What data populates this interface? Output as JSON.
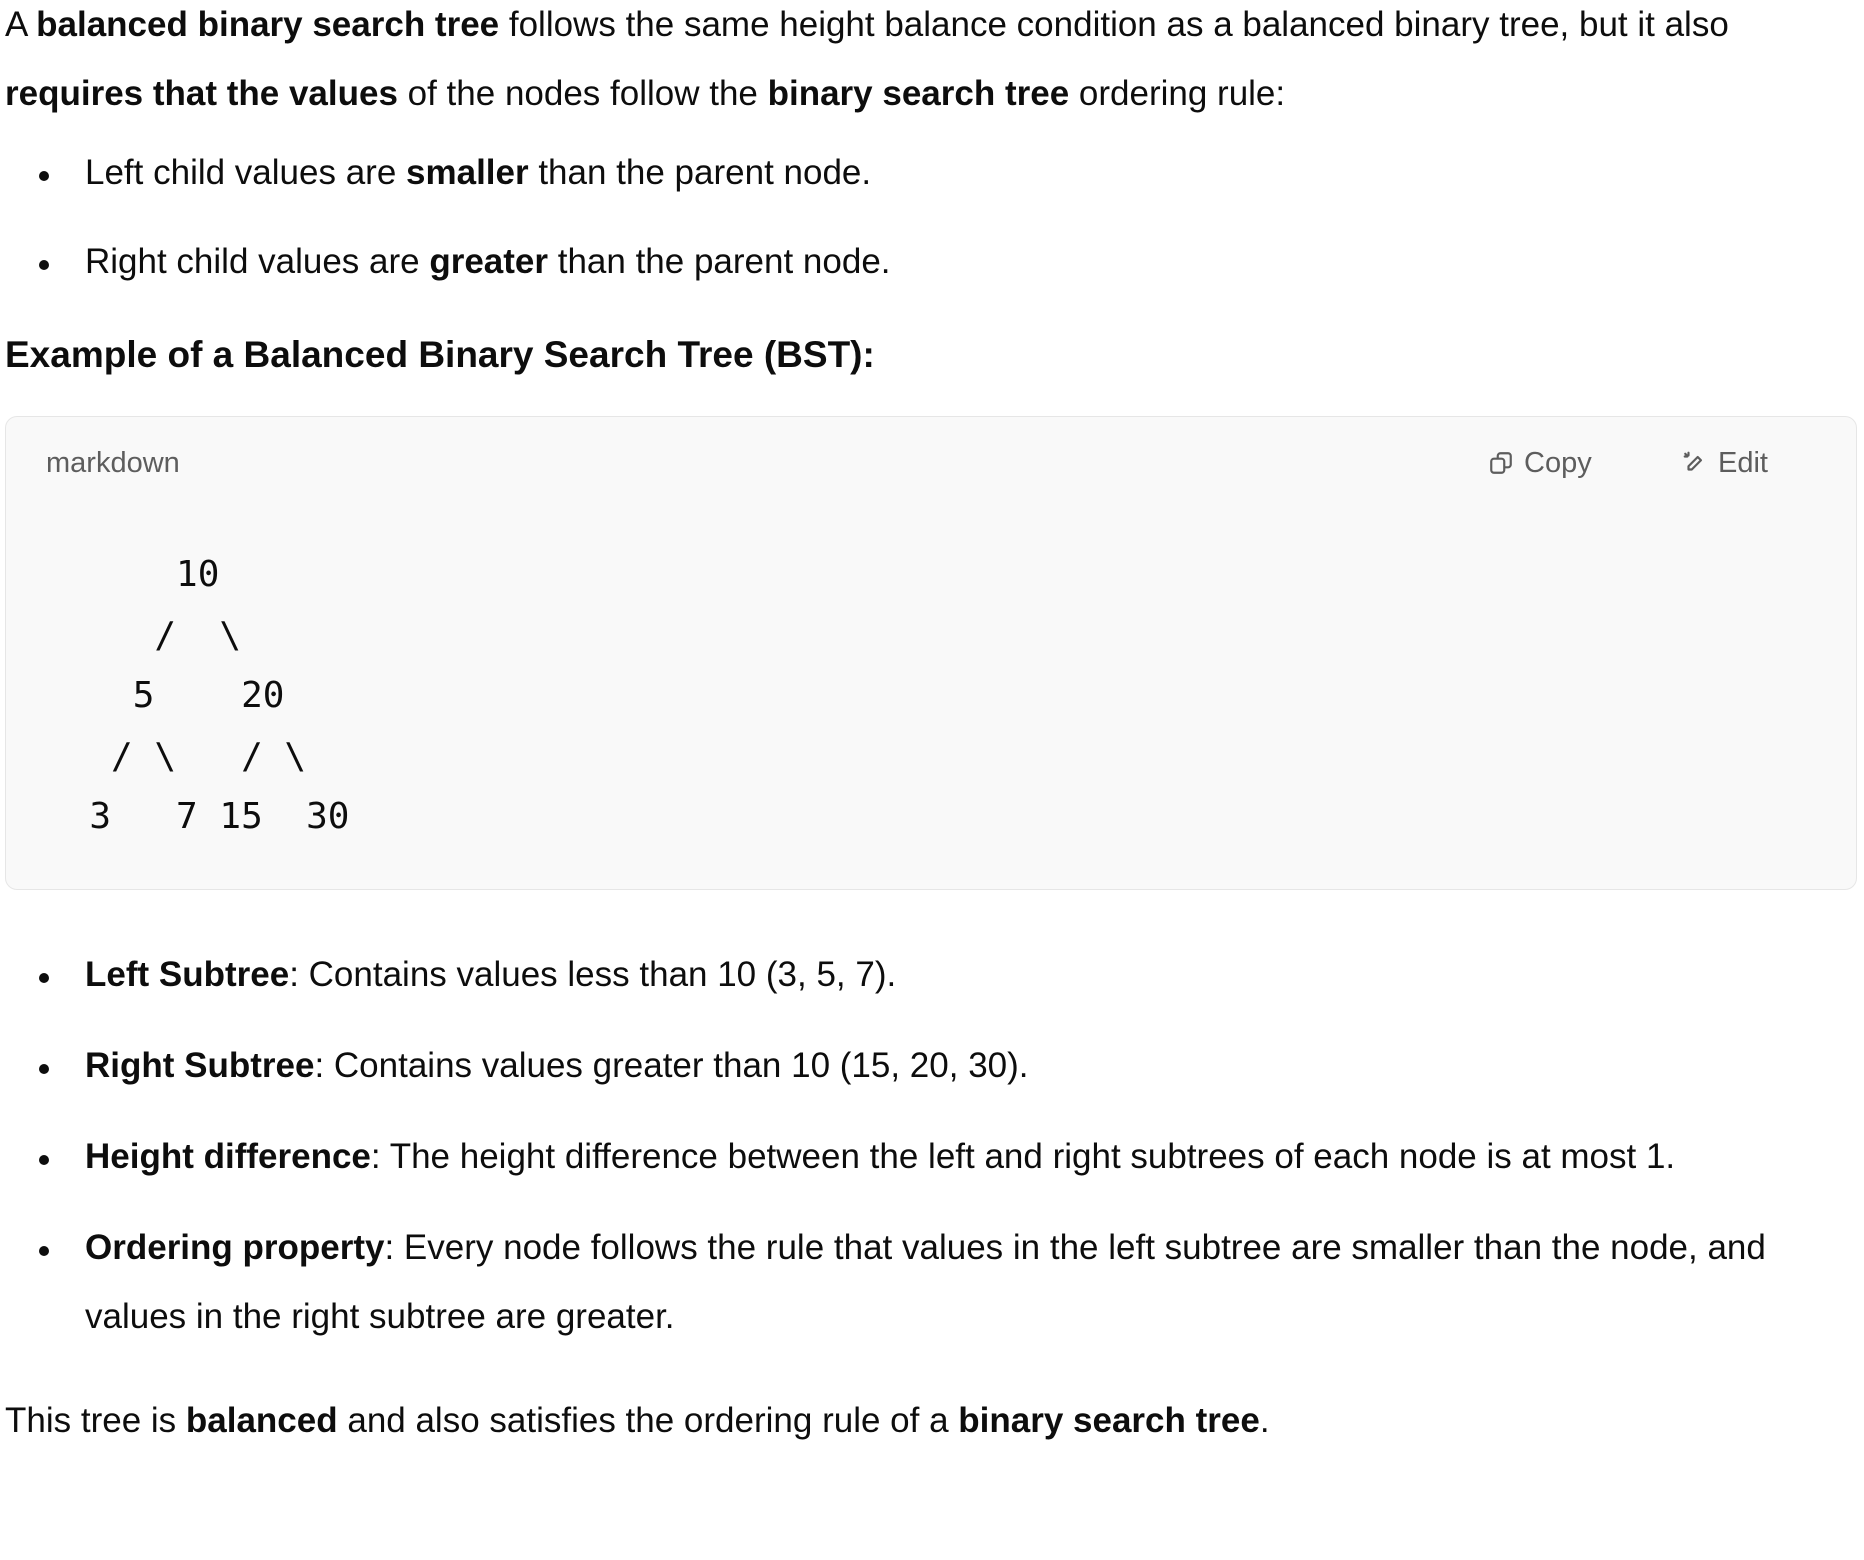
{
  "intro": {
    "t1": "A ",
    "b1": "balanced binary search tree",
    "t2": " follows the same height balance condition as a balanced binary tree, but it also ",
    "b2": "requires that the values",
    "t3": " of the nodes follow the ",
    "b3": "binary search tree",
    "t4": " ordering rule:"
  },
  "rules": [
    {
      "pre": "Left child values are ",
      "bold": "smaller",
      "post": " than the parent node."
    },
    {
      "pre": "Right child values are ",
      "bold": "greater",
      "post": " than the parent node."
    }
  ],
  "example_heading": "Example of a Balanced Binary Search Tree (BST):",
  "code_block": {
    "language": "markdown",
    "copy_label": "Copy",
    "edit_label": "Edit",
    "content": "      10\n     /  \\\n    5    20\n   / \\   / \\\n  3   7 15  30"
  },
  "details": [
    {
      "bold": "Left Subtree",
      "text": ": Contains values less than 10 (3, 5, 7)."
    },
    {
      "bold": "Right Subtree",
      "text": ": Contains values greater than 10 (15, 20, 30)."
    },
    {
      "bold": "Height difference",
      "text": ": The height difference between the left and right subtrees of each node is at most 1."
    },
    {
      "bold": "Ordering property",
      "text": ": Every node follows the rule that values in the left subtree are smaller than the node, and values in the right subtree are greater."
    }
  ],
  "closing": {
    "t1": "This tree is ",
    "b1": "balanced",
    "t2": " and also satisfies the ordering rule of a ",
    "b2": "binary search tree",
    "t3": "."
  }
}
